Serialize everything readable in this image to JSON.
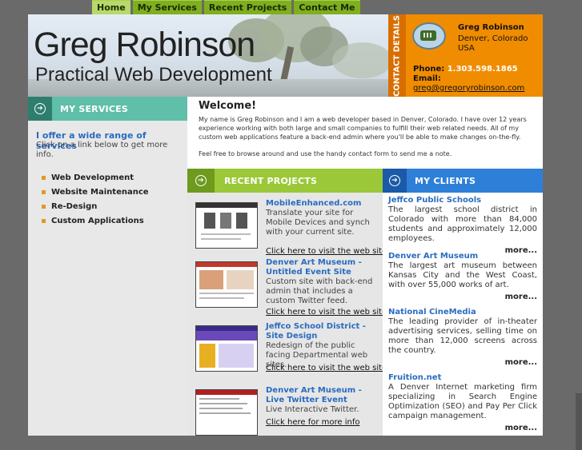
{
  "nav": {
    "tabs": [
      {
        "label": "Home"
      },
      {
        "label": "My Services"
      },
      {
        "label": "Recent Projects"
      },
      {
        "label": "Contact Me"
      }
    ]
  },
  "header": {
    "name": "Greg Robinson",
    "tagline": "Practical Web Development"
  },
  "contact": {
    "tab_label": "CONTACT DETAILS",
    "name": "Greg Robinson",
    "location": "Denver, Colorado USA",
    "phone_label": "Phone:",
    "phone": "1.303.598.1865",
    "email_label": "Email:",
    "email": "greg@gregoryrobinson.com"
  },
  "services": {
    "heading": "MY SERVICES",
    "intro_strong": "I offer a wide range of services",
    "intro": "Click on a link below to get more info.",
    "items": [
      {
        "label": "Web Development"
      },
      {
        "label": "Website Maintenance"
      },
      {
        "label": "Re-Design"
      },
      {
        "label": "Custom Applications"
      }
    ]
  },
  "welcome": {
    "title": "Welcome!",
    "para1": "My name is Greg Robinson and I am a web developer based in Denver, Colorado. I have over 12 years experience working with both large and small companies to fulfill their web related needs. All of my custom web applications feature a back-end admin where you'll be able to make changes on-the-fly.",
    "para2": "Feel free to browse around and use the handy contact form to send me a note."
  },
  "projects": {
    "heading": "RECENT PROJECTS",
    "items": [
      {
        "title": "MobileEnhanced.com",
        "desc": "Translate your site for Mobile Devices and synch with your current site.",
        "link": "Click here to visit the web site"
      },
      {
        "title": "Denver Art Museum - Untitled Event Site",
        "desc": "Custom site with back-end admin that includes a custom Twitter feed.",
        "link": "Click here to visit the web site"
      },
      {
        "title": "Jeffco School District - Site Design",
        "desc": "Redesign of the public facing Departmental web sites.",
        "link": "Click here to visit the web site"
      },
      {
        "title": "Denver Art Museum - Live Twitter Event",
        "desc": "Live Interactive Twitter.",
        "link": "Click here for more info"
      }
    ]
  },
  "clients": {
    "heading": "MY CLIENTS",
    "more_label": "more...",
    "items": [
      {
        "title": "Jeffco Public Schools",
        "desc": "The largest school district in Colorado with more than 84,000 students and approximately 12,000 employees."
      },
      {
        "title": "Denver Art Museum",
        "desc": "The largest art museum between Kansas City and the West Coast, with over 55,000 works of art."
      },
      {
        "title": "National CineMedia",
        "desc": "The leading provider of in-theater advertising services, selling time on more than 12,000 screens across the country."
      },
      {
        "title": "Fruition.net",
        "desc": "A Denver Internet marketing firm specializing in Search Engine Optimization (SEO) and Pay Per Click campaign management."
      }
    ]
  },
  "colors": {
    "nav_green": "#7faf1f",
    "contact_orange": "#f08c00",
    "services_teal": "#5fbfa8",
    "projects_green": "#9ac838",
    "clients_blue": "#2e7fd8",
    "link_blue": "#2a6cc0"
  }
}
